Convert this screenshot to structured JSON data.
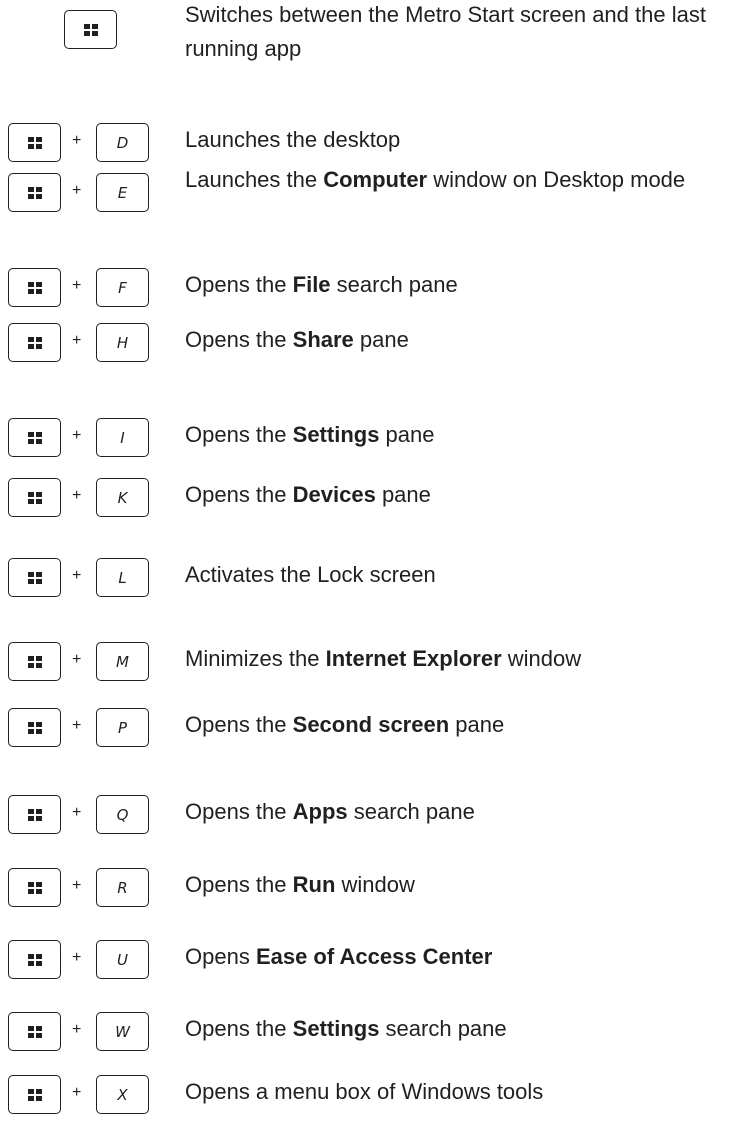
{
  "shortcuts": [
    {
      "win_only": true,
      "key": "",
      "plus": "",
      "pre": "Switches between the Metro Start screen and the last running app",
      "bold": "",
      "post": ""
    },
    {
      "key": "D",
      "plus": "+",
      "pre": "Launches the desktop",
      "bold": "",
      "post": ""
    },
    {
      "key": "E",
      "plus": "+",
      "pre": "Launches the ",
      "bold": "Computer",
      "post": " window on Desktop mode"
    },
    {
      "key": "F",
      "plus": "+",
      "pre": "Opens the ",
      "bold": "File",
      "post": " search pane"
    },
    {
      "key": "H",
      "plus": "+",
      "pre": "Opens the ",
      "bold": "Share",
      "post": " pane"
    },
    {
      "key": "I",
      "plus": "+",
      "pre": "Opens the ",
      "bold": "Settings",
      "post": " pane"
    },
    {
      "key": "K",
      "plus": "+",
      "pre": "Opens the ",
      "bold": "Devices",
      "post": " pane"
    },
    {
      "key": "L",
      "plus": "+",
      "pre": "Activates the Lock screen",
      "bold": "",
      "post": ""
    },
    {
      "key": "M",
      "plus": "+",
      "pre": "Minimizes the ",
      "bold": "Internet Explorer",
      "post": " window"
    },
    {
      "key": "P",
      "plus": "+",
      "pre": "Opens the ",
      "bold": "Second screen",
      "post": " pane"
    },
    {
      "key": "Q",
      "plus": "+",
      "pre": "Opens the ",
      "bold": "Apps",
      "post": " search pane"
    },
    {
      "key": "R",
      "plus": "+",
      "pre": "Opens the ",
      "bold": "Run",
      "post": " window"
    },
    {
      "key": "U",
      "plus": "+",
      "pre": "Opens ",
      "bold": "Ease of Access Center",
      "post": ""
    },
    {
      "key": "W",
      "plus": "+",
      "pre": "Opens the ",
      "bold": "Settings",
      "post": " search pane"
    },
    {
      "key": "X",
      "plus": "+",
      "pre": "Opens a menu box of Windows tools",
      "bold": "",
      "post": ""
    }
  ],
  "icons": {
    "windows_key": "windows-logo-icon"
  }
}
